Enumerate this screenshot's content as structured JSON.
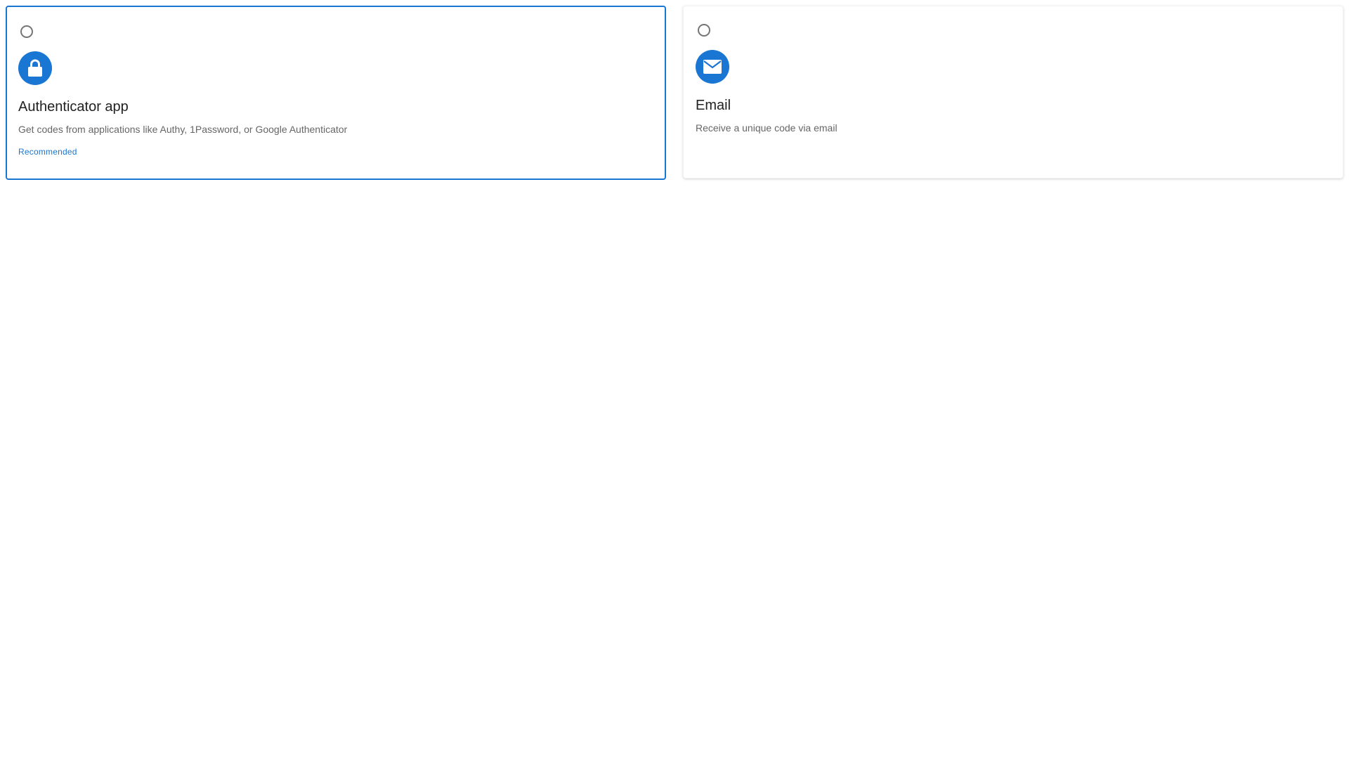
{
  "options": [
    {
      "id": "authenticator",
      "selected_style": true,
      "icon": "lock-icon",
      "title": "Authenticator app",
      "description": "Get codes from applications like Authy, 1Password, or Google Authenticator",
      "badge": "Recommended"
    },
    {
      "id": "email",
      "selected_style": false,
      "icon": "envelope-icon",
      "title": "Email",
      "description": "Receive a unique code via email"
    }
  ],
  "colors": {
    "accent": "#1976d2",
    "title_text": "#212121",
    "secondary_text": "#666666",
    "radio_border": "#757575"
  }
}
